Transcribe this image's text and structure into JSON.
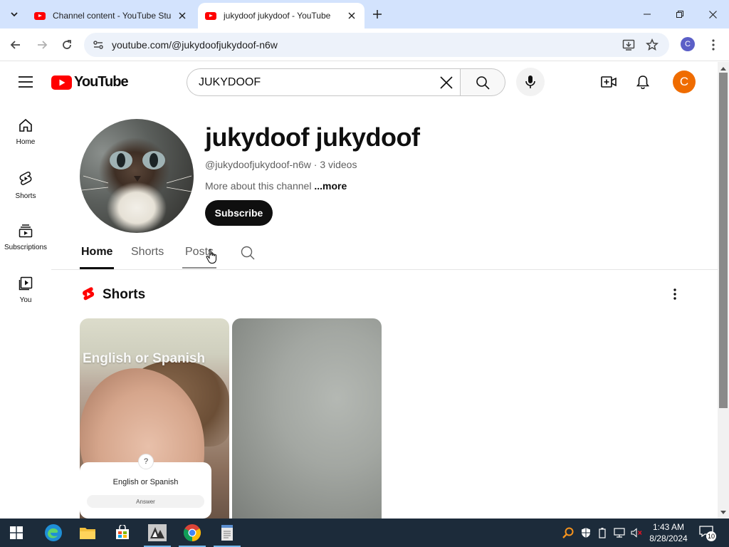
{
  "browser": {
    "tabs": [
      {
        "title": "Channel content - YouTube Stu",
        "active": false
      },
      {
        "title": "jukydoof jukydoof - YouTube",
        "active": true
      }
    ],
    "url": "youtube.com/@jukydoofjukydoof-n6w",
    "profile_initial": "C"
  },
  "youtube": {
    "logo_text": "YouTube",
    "search": {
      "value": "JUKYDOOF"
    },
    "avatar_initial": "C",
    "guide": [
      {
        "label": "Home",
        "icon": "home-icon"
      },
      {
        "label": "Shorts",
        "icon": "shorts-icon"
      },
      {
        "label": "Subscriptions",
        "icon": "subscriptions-icon"
      },
      {
        "label": "You",
        "icon": "you-icon"
      }
    ]
  },
  "channel": {
    "name": "jukydoof jukydoof",
    "handle": "@jukydoofjukydoof-n6w",
    "separator": " · ",
    "video_count": "3 videos",
    "about_text": "More about this channel",
    "more_link": "...more",
    "subscribe_label": "Subscribe",
    "tabs": [
      {
        "label": "Home",
        "selected": true
      },
      {
        "label": "Shorts",
        "selected": false
      },
      {
        "label": "Posts",
        "selected": false
      }
    ]
  },
  "shelf": {
    "title": "Shorts",
    "shorts": [
      {
        "overlay_text": "English or Spanish",
        "question": "English or Spanish",
        "answer_label": "Answer"
      },
      {
        "overlay_text": ""
      }
    ]
  },
  "taskbar": {
    "apps": [
      "start-icon",
      "edge-icon",
      "file-explorer-icon",
      "store-icon",
      "app-icon",
      "chrome-icon",
      "notepad-icon"
    ],
    "time": "1:43 AM",
    "date": "8/28/2024",
    "notification_count": "10"
  },
  "colors": {
    "youtube_red": "#ff0000",
    "avatar_orange": "#ef6c00",
    "tab_strip": "#d3e3fd",
    "taskbar": "#1c2b3a"
  }
}
